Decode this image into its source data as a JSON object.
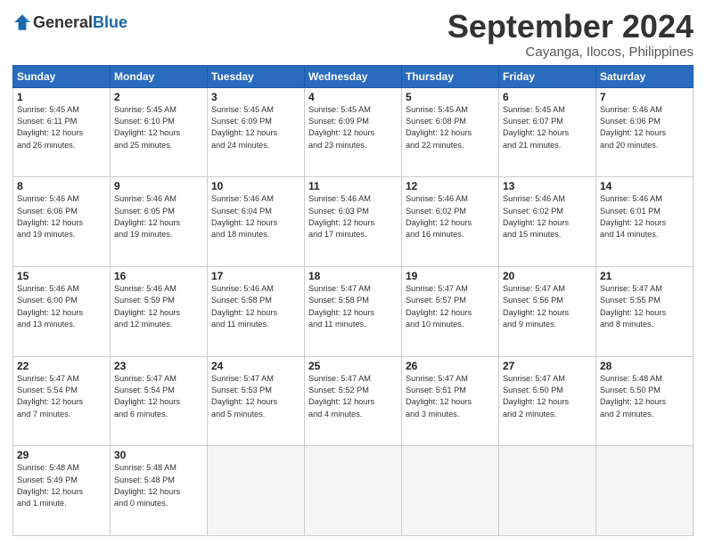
{
  "header": {
    "logo": "GeneralBlue",
    "month": "September 2024",
    "location": "Cayanga, Ilocos, Philippines"
  },
  "weekdays": [
    "Sunday",
    "Monday",
    "Tuesday",
    "Wednesday",
    "Thursday",
    "Friday",
    "Saturday"
  ],
  "weeks": [
    [
      {
        "day": 1,
        "sunrise": "5:45 AM",
        "sunset": "6:11 PM",
        "daylight": "12 hours and 26 minutes."
      },
      {
        "day": 2,
        "sunrise": "5:45 AM",
        "sunset": "6:10 PM",
        "daylight": "12 hours and 25 minutes."
      },
      {
        "day": 3,
        "sunrise": "5:45 AM",
        "sunset": "6:09 PM",
        "daylight": "12 hours and 24 minutes."
      },
      {
        "day": 4,
        "sunrise": "5:45 AM",
        "sunset": "6:09 PM",
        "daylight": "12 hours and 23 minutes."
      },
      {
        "day": 5,
        "sunrise": "5:45 AM",
        "sunset": "6:08 PM",
        "daylight": "12 hours and 22 minutes."
      },
      {
        "day": 6,
        "sunrise": "5:45 AM",
        "sunset": "6:07 PM",
        "daylight": "12 hours and 21 minutes."
      },
      {
        "day": 7,
        "sunrise": "5:46 AM",
        "sunset": "6:06 PM",
        "daylight": "12 hours and 20 minutes."
      }
    ],
    [
      {
        "day": 8,
        "sunrise": "5:46 AM",
        "sunset": "6:06 PM",
        "daylight": "12 hours and 19 minutes."
      },
      {
        "day": 9,
        "sunrise": "5:46 AM",
        "sunset": "6:05 PM",
        "daylight": "12 hours and 19 minutes."
      },
      {
        "day": 10,
        "sunrise": "5:46 AM",
        "sunset": "6:04 PM",
        "daylight": "12 hours and 18 minutes."
      },
      {
        "day": 11,
        "sunrise": "5:46 AM",
        "sunset": "6:03 PM",
        "daylight": "12 hours and 17 minutes."
      },
      {
        "day": 12,
        "sunrise": "5:46 AM",
        "sunset": "6:02 PM",
        "daylight": "12 hours and 16 minutes."
      },
      {
        "day": 13,
        "sunrise": "5:46 AM",
        "sunset": "6:02 PM",
        "daylight": "12 hours and 15 minutes."
      },
      {
        "day": 14,
        "sunrise": "5:46 AM",
        "sunset": "6:01 PM",
        "daylight": "12 hours and 14 minutes."
      }
    ],
    [
      {
        "day": 15,
        "sunrise": "5:46 AM",
        "sunset": "6:00 PM",
        "daylight": "12 hours and 13 minutes."
      },
      {
        "day": 16,
        "sunrise": "5:46 AM",
        "sunset": "5:59 PM",
        "daylight": "12 hours and 12 minutes."
      },
      {
        "day": 17,
        "sunrise": "5:46 AM",
        "sunset": "5:58 PM",
        "daylight": "12 hours and 11 minutes."
      },
      {
        "day": 18,
        "sunrise": "5:47 AM",
        "sunset": "5:58 PM",
        "daylight": "12 hours and 11 minutes."
      },
      {
        "day": 19,
        "sunrise": "5:47 AM",
        "sunset": "5:57 PM",
        "daylight": "12 hours and 10 minutes."
      },
      {
        "day": 20,
        "sunrise": "5:47 AM",
        "sunset": "5:56 PM",
        "daylight": "12 hours and 9 minutes."
      },
      {
        "day": 21,
        "sunrise": "5:47 AM",
        "sunset": "5:55 PM",
        "daylight": "12 hours and 8 minutes."
      }
    ],
    [
      {
        "day": 22,
        "sunrise": "5:47 AM",
        "sunset": "5:54 PM",
        "daylight": "12 hours and 7 minutes."
      },
      {
        "day": 23,
        "sunrise": "5:47 AM",
        "sunset": "5:54 PM",
        "daylight": "12 hours and 6 minutes."
      },
      {
        "day": 24,
        "sunrise": "5:47 AM",
        "sunset": "5:53 PM",
        "daylight": "12 hours and 5 minutes."
      },
      {
        "day": 25,
        "sunrise": "5:47 AM",
        "sunset": "5:52 PM",
        "daylight": "12 hours and 4 minutes."
      },
      {
        "day": 26,
        "sunrise": "5:47 AM",
        "sunset": "5:51 PM",
        "daylight": "12 hours and 3 minutes."
      },
      {
        "day": 27,
        "sunrise": "5:47 AM",
        "sunset": "5:50 PM",
        "daylight": "12 hours and 2 minutes."
      },
      {
        "day": 28,
        "sunrise": "5:48 AM",
        "sunset": "5:50 PM",
        "daylight": "12 hours and 2 minutes."
      }
    ],
    [
      {
        "day": 29,
        "sunrise": "5:48 AM",
        "sunset": "5:49 PM",
        "daylight": "12 hours and 1 minute."
      },
      {
        "day": 30,
        "sunrise": "5:48 AM",
        "sunset": "5:48 PM",
        "daylight": "12 hours and 0 minutes."
      },
      null,
      null,
      null,
      null,
      null
    ]
  ]
}
